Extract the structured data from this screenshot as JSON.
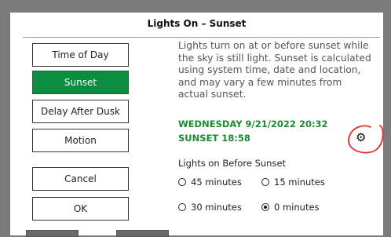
{
  "dialog": {
    "title": "Lights On – Sunset"
  },
  "menu": {
    "time_of_day": "Time of Day",
    "sunset": "Sunset",
    "delay_after_dusk": "Delay After Dusk",
    "motion": "Motion"
  },
  "actions": {
    "cancel": "Cancel",
    "ok": "OK"
  },
  "description": {
    "line1": "Lights turn on at or before sunset while",
    "line2": "the sky is still light. Sunset is calculated",
    "line3": "using system time, date and location,",
    "line4": "and may vary a few minutes from",
    "line5": "actual sunset."
  },
  "status": {
    "datetime": "WEDNESDAY  9/21/2022  20:32",
    "sunset": "SUNSET  18:58"
  },
  "settings_icon": "gear-icon",
  "options": {
    "heading": "Lights on Before Sunset",
    "items": [
      {
        "label": "45 minutes",
        "selected": false
      },
      {
        "label": "15 minutes",
        "selected": false
      },
      {
        "label": "30 minutes",
        "selected": false
      },
      {
        "label": "0 minutes",
        "selected": true
      }
    ]
  },
  "colors": {
    "accent_green": "#0c8d3f",
    "status_green": "#1d8a32",
    "annotation_red": "#e0302a"
  }
}
